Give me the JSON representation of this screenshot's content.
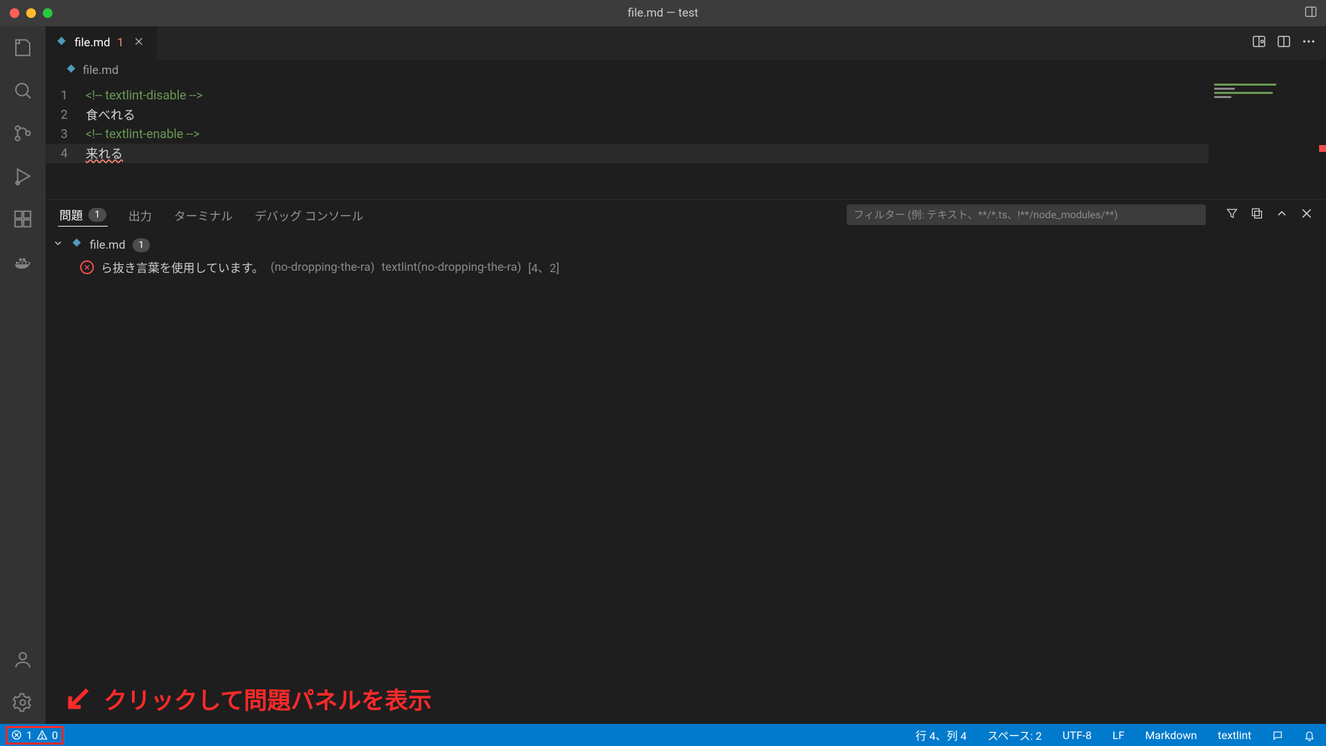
{
  "window": {
    "title": "file.md — test"
  },
  "activitybar": {
    "items": [
      "explorer",
      "search",
      "source-control",
      "run",
      "extensions",
      "remote"
    ],
    "bottom": [
      "account",
      "settings"
    ]
  },
  "tab": {
    "filename": "file.md",
    "problem_count": "1"
  },
  "breadcrumb": {
    "filename": "file.md"
  },
  "editor": {
    "lines": [
      {
        "num": "1",
        "text": "<!-- textlint-disable -->",
        "kind": "comment"
      },
      {
        "num": "2",
        "text": "食べれる",
        "kind": "text"
      },
      {
        "num": "3",
        "text": "<!-- textlint-enable -->",
        "kind": "comment"
      },
      {
        "num": "4",
        "text": "来れる",
        "kind": "text",
        "squiggle": true,
        "current": true
      }
    ]
  },
  "panel": {
    "tabs": {
      "problems": "問題",
      "problems_count": "1",
      "output": "出力",
      "terminal": "ターミナル",
      "debug": "デバッグ コンソール"
    },
    "filter_placeholder": "フィルター (例: テキスト、**/*.ts、!**/node_modules/**)",
    "problem_file": {
      "name": "file.md",
      "count": "1"
    },
    "problem_item": {
      "message": "ら抜き言葉を使用しています。",
      "rule": "(no-dropping-the-ra)",
      "source": "textlint(no-dropping-the-ra)",
      "location": "[4、2]"
    }
  },
  "annotation": {
    "text": "クリックして問題パネルを表示"
  },
  "statusbar": {
    "errors": "1",
    "warnings": "0",
    "cursor": "行 4、列 4",
    "spaces": "スペース: 2",
    "encoding": "UTF-8",
    "eol": "LF",
    "language": "Markdown",
    "linter": "textlint"
  }
}
